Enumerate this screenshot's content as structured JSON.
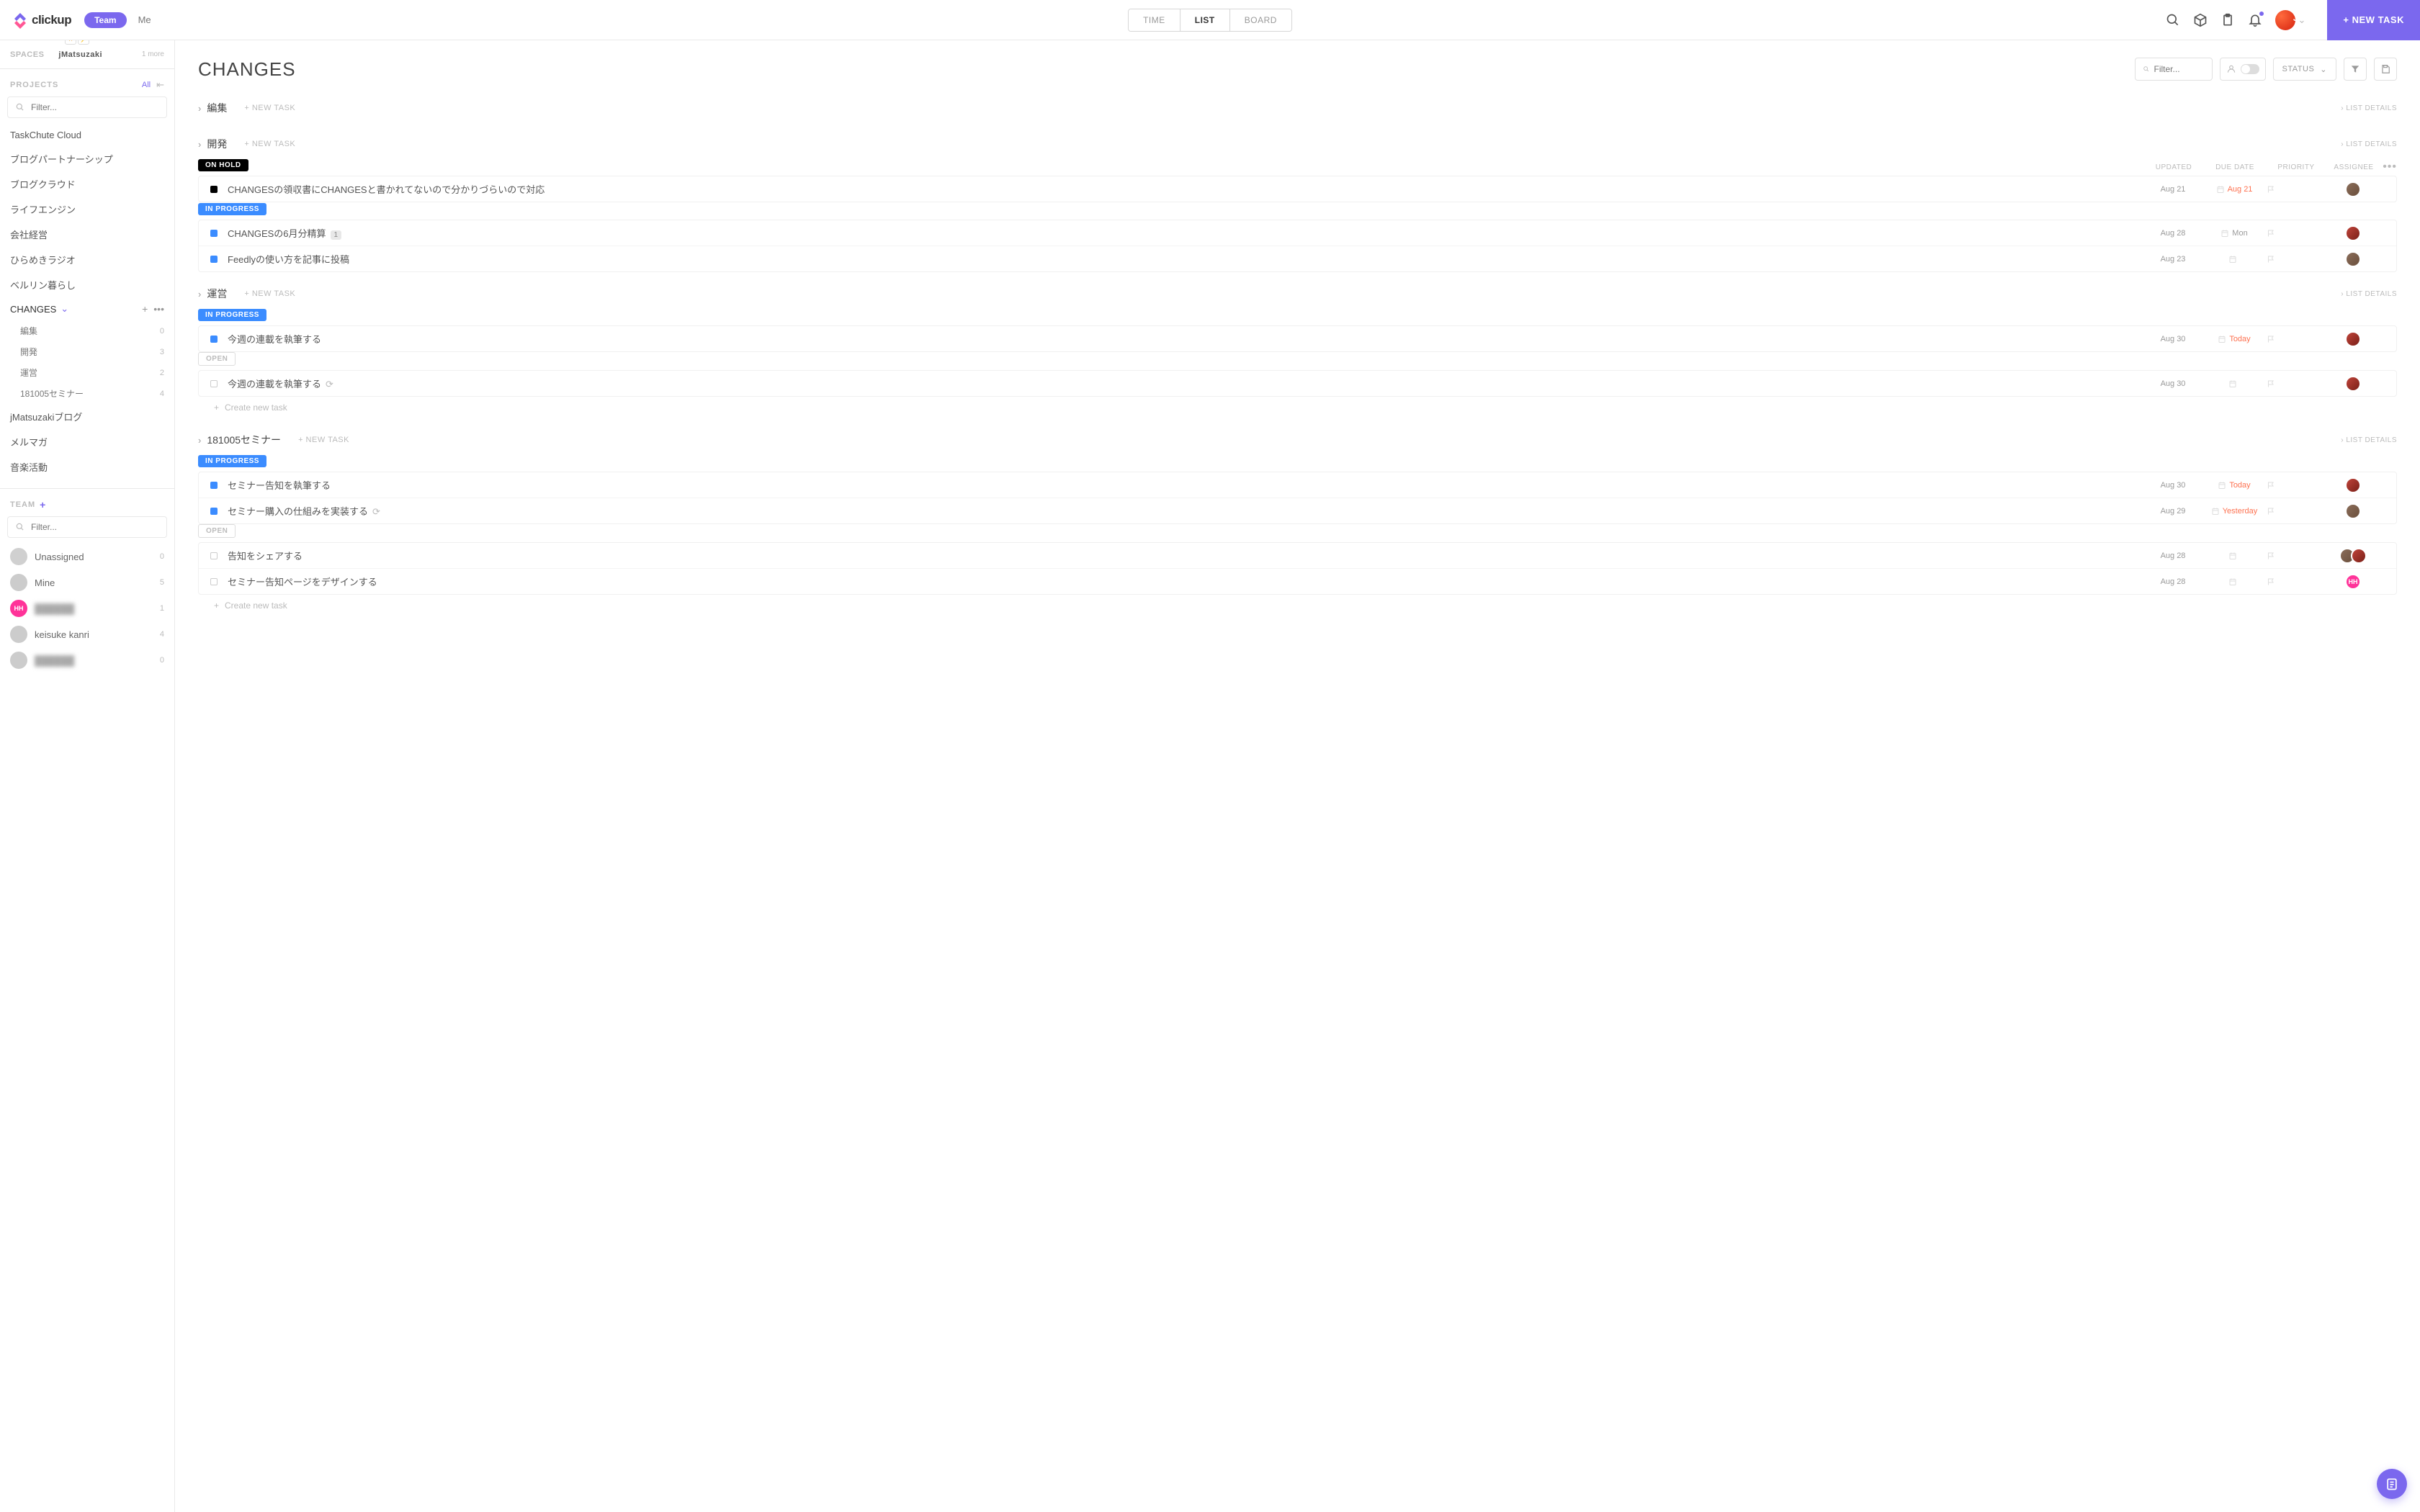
{
  "header": {
    "logo_text": "clickup",
    "team_pill": "Team",
    "me_link": "Me",
    "view_tabs": [
      "TIME",
      "LIST",
      "BOARD"
    ],
    "active_view": "LIST",
    "new_task": "+ NEW TASK"
  },
  "sidebar": {
    "spaces_label": "SPACES",
    "active_space": "jMatsuzaki",
    "more_spaces": "1 more",
    "projects_label": "PROJECTS",
    "projects_all": "All",
    "filter_placeholder": "Filter...",
    "projects": [
      {
        "name": "TaskChute Cloud"
      },
      {
        "name": "ブログパートナーシップ"
      },
      {
        "name": "ブログクラウド"
      },
      {
        "name": "ライフエンジン"
      },
      {
        "name": "会社経営"
      },
      {
        "name": "ひらめきラジオ"
      },
      {
        "name": "ベルリン暮らし"
      },
      {
        "name": "CHANGES",
        "active": true,
        "expanded": true,
        "sublists": [
          {
            "name": "編集",
            "count": "0"
          },
          {
            "name": "開発",
            "count": "3"
          },
          {
            "name": "運営",
            "count": "2"
          },
          {
            "name": "181005セミナー",
            "count": "4"
          }
        ]
      },
      {
        "name": "jMatsuzakiブログ"
      },
      {
        "name": "メルマガ"
      },
      {
        "name": "音楽活動"
      }
    ],
    "team_label": "TEAM",
    "team_filter_placeholder": "Filter...",
    "team": [
      {
        "name": "Unassigned",
        "count": "0",
        "cls": "unass"
      },
      {
        "name": "Mine",
        "count": "5",
        "cls": "a2"
      },
      {
        "name": "██████",
        "count": "1",
        "cls": "hh",
        "initials": "HH",
        "blur": true
      },
      {
        "name": "keisuke kanri",
        "count": "4",
        "cls": "a1"
      },
      {
        "name": "██████",
        "count": "0",
        "cls": "",
        "blur": true
      }
    ]
  },
  "main": {
    "title": "CHANGES",
    "filter_placeholder": "Filter...",
    "status_label": "STATUS",
    "list_details": "LIST DETAILS",
    "new_task": "+ NEW TASK",
    "create_task": "Create new task",
    "columns": {
      "updated": "UPDATED",
      "due": "DUE DATE",
      "priority": "PRIORITY",
      "assignee": "ASSIGNEE"
    },
    "groups": [
      {
        "name": "編集",
        "show_header": true,
        "blocks": []
      },
      {
        "name": "開発",
        "show_header": true,
        "show_columns": true,
        "blocks": [
          {
            "status": "ON HOLD",
            "status_cls": "onhold",
            "tasks": [
              {
                "title": "CHANGESの領収書にCHANGESと書かれてないので分かりづらいので対応",
                "updated": "Aug 21",
                "due": "Aug 21",
                "overdue": true,
                "sq": "onhold",
                "assignees": [
                  "a1"
                ]
              }
            ]
          },
          {
            "status": "IN PROGRESS",
            "status_cls": "inprogress",
            "tasks": [
              {
                "title": "CHANGESの6月分精算",
                "badge": "1",
                "updated": "Aug 28",
                "due": "Mon",
                "sq": "inprogress",
                "assignees": [
                  "a2"
                ]
              },
              {
                "title": "Feedlyの使い方を記事に投稿",
                "updated": "Aug 23",
                "due": "",
                "sq": "inprogress",
                "assignees": [
                  "a1"
                ]
              }
            ]
          }
        ]
      },
      {
        "name": "運営",
        "show_header": true,
        "blocks": [
          {
            "status": "IN PROGRESS",
            "status_cls": "inprogress",
            "tasks": [
              {
                "title": "今週の連載を執筆する",
                "updated": "Aug 30",
                "due": "Today",
                "overdue": true,
                "sq": "inprogress",
                "assignees": [
                  "a2"
                ]
              }
            ]
          },
          {
            "status": "OPEN",
            "status_cls": "open",
            "tasks": [
              {
                "title": "今週の連載を執筆する",
                "recur": true,
                "updated": "Aug 30",
                "due": "",
                "sq": "open",
                "assignees": [
                  "a2"
                ]
              }
            ],
            "show_create": true
          }
        ]
      },
      {
        "name": "181005セミナー",
        "show_header": true,
        "blocks": [
          {
            "status": "IN PROGRESS",
            "status_cls": "inprogress",
            "tasks": [
              {
                "title": "セミナー告知を執筆する",
                "updated": "Aug 30",
                "due": "Today",
                "overdue": true,
                "sq": "inprogress",
                "assignees": [
                  "a2"
                ]
              },
              {
                "title": "セミナー購入の仕組みを実装する",
                "recur": true,
                "updated": "Aug 29",
                "due": "Yesterday",
                "overdue": true,
                "sq": "inprogress",
                "assignees": [
                  "a1"
                ]
              }
            ]
          },
          {
            "status": "OPEN",
            "status_cls": "open",
            "tasks": [
              {
                "title": "告知をシェアする",
                "updated": "Aug 28",
                "due": "",
                "sq": "open",
                "assignees": [
                  "a1",
                  "a2"
                ]
              },
              {
                "title": "セミナー告知ページをデザインする",
                "updated": "Aug 28",
                "due": "",
                "sq": "open",
                "assignees": [
                  "hh"
                ],
                "initials": "HH"
              }
            ],
            "show_create": true
          }
        ]
      }
    ]
  }
}
